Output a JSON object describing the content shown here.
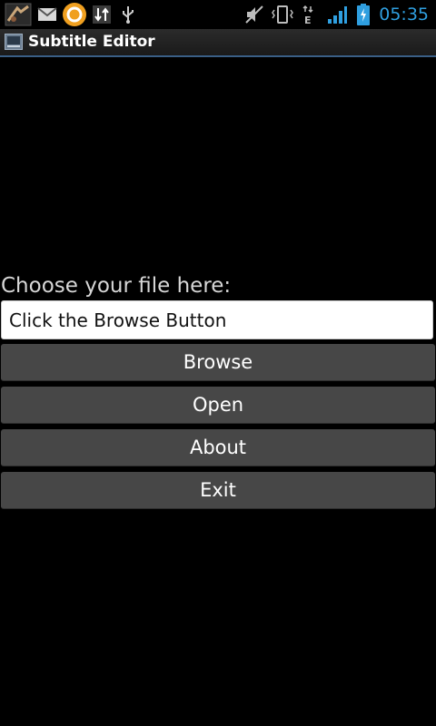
{
  "status_bar": {
    "time": "05:35",
    "time_color": "#2f9fe0",
    "icons": [
      "app-notification-icon",
      "gmail-icon",
      "orange-circle-notification-icon",
      "sync-arrows-icon",
      "usb-icon",
      "mute-icon",
      "vibrate-icon",
      "edge-data-icon",
      "signal-strength-icon",
      "battery-charging-icon"
    ]
  },
  "title_bar": {
    "title": "Subtitle Editor",
    "icon": "app-icon"
  },
  "main": {
    "choose_label": "Choose your file here:",
    "file_input": {
      "value": "Click the Browse Button"
    },
    "buttons": {
      "browse": "Browse",
      "open": "Open",
      "about": "About",
      "exit": "Exit"
    }
  },
  "colors": {
    "background": "#000000",
    "button_bg": "#474747",
    "title_underline": "#3a5f86",
    "label_text": "#d7d7d7"
  }
}
